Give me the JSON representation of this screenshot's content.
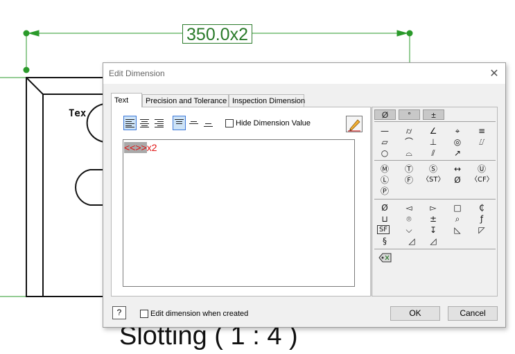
{
  "drawing": {
    "dimension_value": "350.0x2",
    "view_label": "Slotting ( 1 : 4 )",
    "note_text": "Tex"
  },
  "dialog": {
    "title": "Edit Dimension",
    "close_icon": "close-icon",
    "tabs": [
      {
        "label": "Text",
        "active": true
      },
      {
        "label": "Precision and Tolerance",
        "active": false
      },
      {
        "label": "Inspection Dimension",
        "active": false
      }
    ],
    "text_tab": {
      "hide_dimension_value_label": "Hide Dimension Value",
      "hide_dimension_value_checked": false,
      "editor": {
        "placeholder_token": "<<>>",
        "suffix": "x2"
      },
      "alignment_buttons": [
        "align-left",
        "align-center",
        "align-right"
      ],
      "vertical_buttons": [
        "align-top",
        "align-middle",
        "align-bottom"
      ],
      "pencil_icon": "pencil-icon"
    },
    "symbols": {
      "tabs": [
        "Ø",
        "°",
        "±"
      ],
      "group1": [
        "—",
        "⌭",
        "∠",
        "⌖",
        "≡",
        "▱",
        "⌒",
        "⊥",
        "◎",
        "⌰",
        "○",
        "⌓",
        "⫽",
        "↗"
      ],
      "group2": [
        "Ⓜ",
        "Ⓣ",
        "Ⓢ",
        "↔",
        "Ⓤ",
        "Ⓛ",
        "Ⓕ",
        "〈ST〉",
        "Ø",
        "〈CF〉",
        "Ⓟ"
      ],
      "group3": [
        "Ø",
        "◅",
        "▻",
        "□",
        "₵",
        "⊔",
        "⌾",
        "±",
        "⌕",
        "ƒ",
        "SF",
        "⌵",
        "↧",
        "◺",
        "◸",
        "§",
        "◿",
        "◿"
      ],
      "group4_icon": "tag-icon"
    },
    "footer": {
      "help_label": "?",
      "edit_when_created_label": "Edit dimension when created",
      "edit_when_created_checked": false,
      "ok_label": "OK",
      "cancel_label": "Cancel"
    }
  },
  "colors": {
    "dimension_green": "#2a7a2a",
    "editor_text_red": "#e01010",
    "selection_blue": "#3b78d8"
  }
}
